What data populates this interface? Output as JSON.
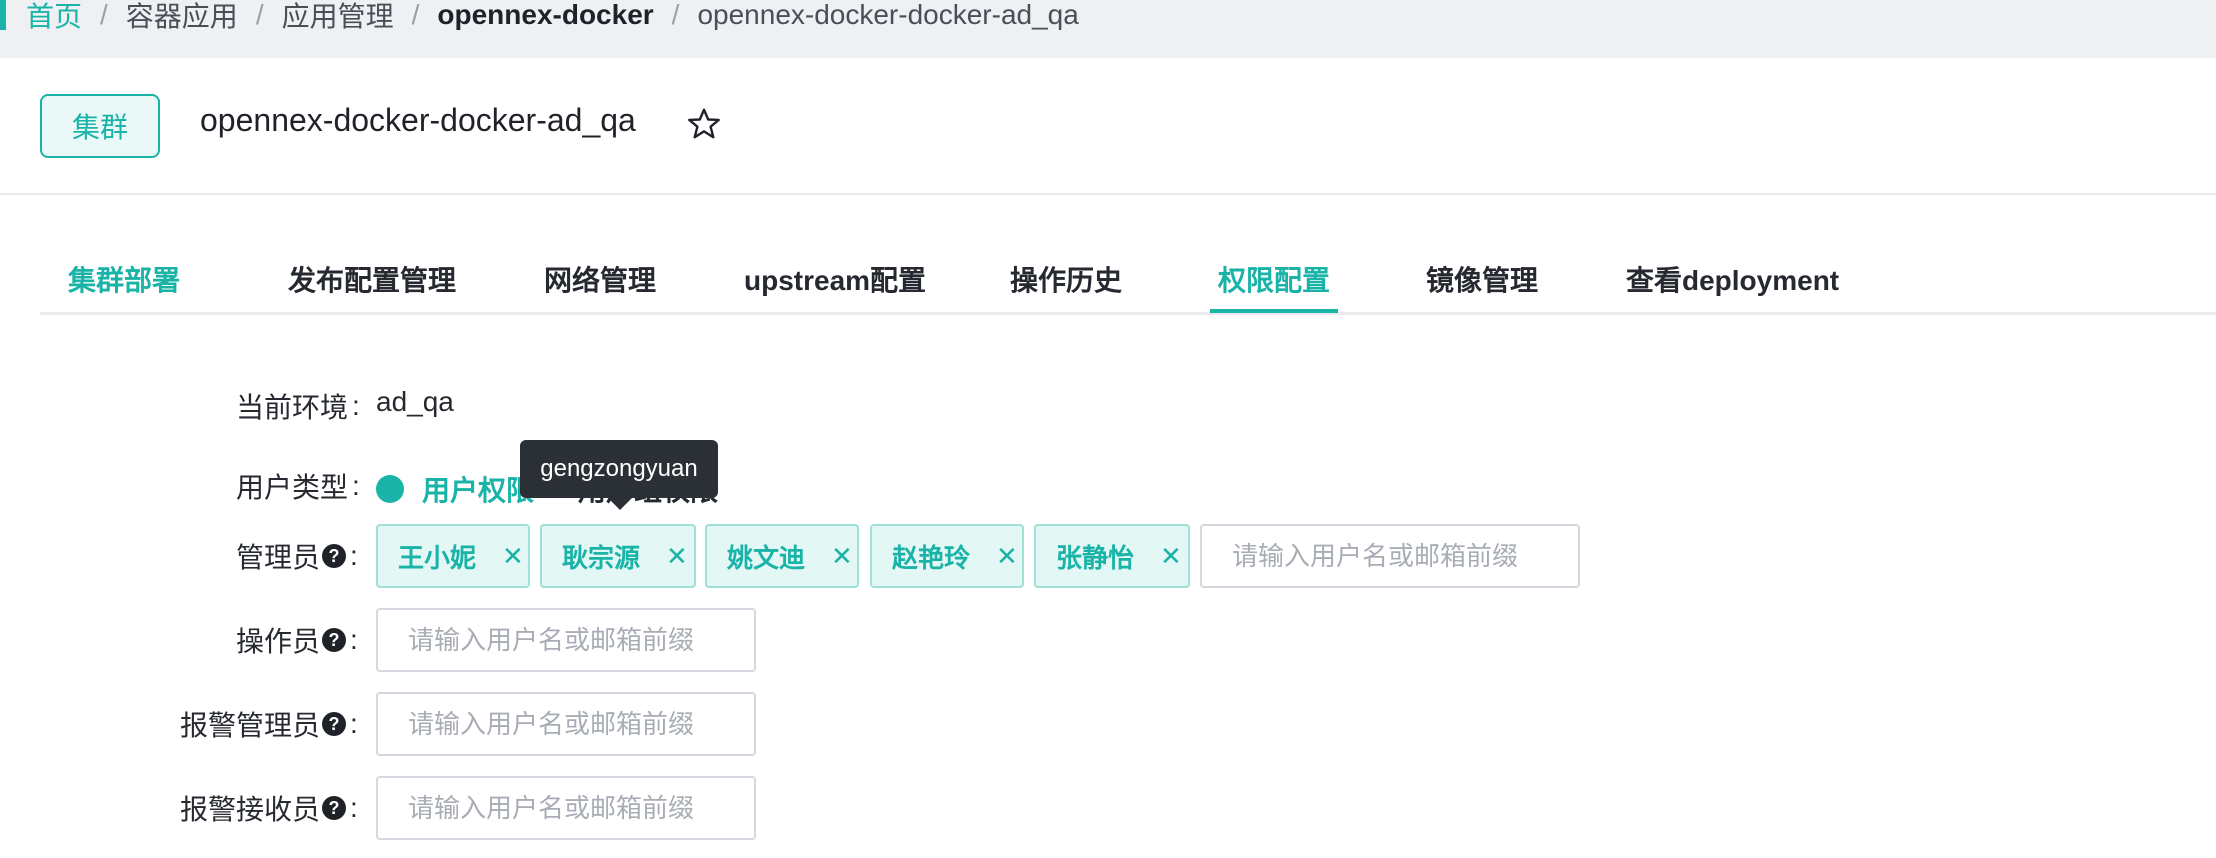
{
  "breadcrumb": {
    "items": [
      "首页",
      "容器应用",
      "应用管理",
      "opennex-docker",
      "opennex-docker-docker-ad_qa"
    ],
    "separator": "/"
  },
  "header": {
    "tag": "集群",
    "title": "opennex-docker-docker-ad_qa",
    "favorite_icon": "star-outline-icon"
  },
  "tabs": [
    {
      "label": "集群部署",
      "active": false
    },
    {
      "label": "发布配置管理",
      "active": false
    },
    {
      "label": "网络管理",
      "active": false
    },
    {
      "label": "upstream配置",
      "active": false
    },
    {
      "label": "操作历史",
      "active": false
    },
    {
      "label": "权限配置",
      "active": true
    },
    {
      "label": "镜像管理",
      "active": false
    },
    {
      "label": "查看deployment",
      "active": false
    }
  ],
  "form": {
    "env": {
      "label": "当前环境",
      "value": "ad_qa"
    },
    "user_type": {
      "label": "用户类型",
      "options": [
        {
          "label": "用户权限",
          "checked": true
        },
        {
          "label": "用户组权限",
          "checked": false
        }
      ]
    },
    "admins": {
      "label": "管理员",
      "chips": [
        "王小妮",
        "耿宗源",
        "姚文迪",
        "赵艳玲",
        "张静怡"
      ],
      "placeholder": "请输入用户名或邮箱前缀"
    },
    "operators": {
      "label": "操作员",
      "placeholder": "请输入用户名或邮箱前缀"
    },
    "alert_admins": {
      "label": "报警管理员",
      "placeholder": "请输入用户名或邮箱前缀"
    },
    "alert_receivers": {
      "label": "报警接收员",
      "placeholder": "请输入用户名或邮箱前缀"
    },
    "colon": ":"
  },
  "tooltip": {
    "text": "gengzongyuan"
  },
  "colors": {
    "accent": "#1ab3a7",
    "chip_bg": "#e3f7f5",
    "chip_border": "#9fe0d9",
    "tooltip_bg": "#2b2f36"
  }
}
